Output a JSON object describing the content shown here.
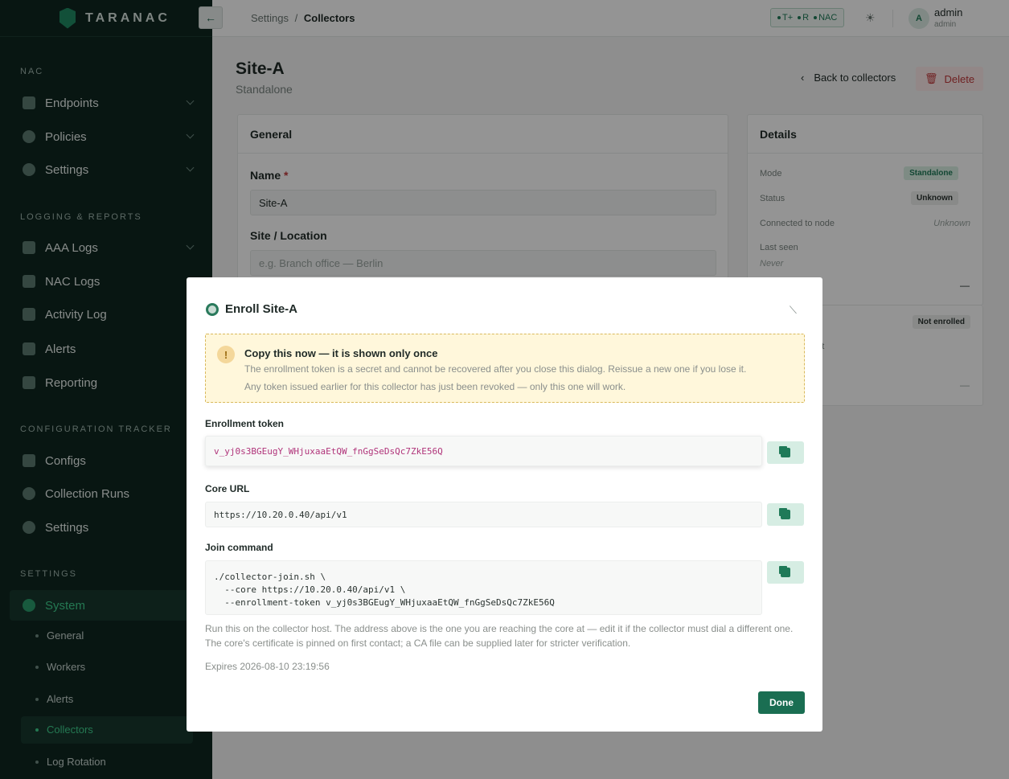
{
  "brand": {
    "name": "TARANAC"
  },
  "sidebar": {
    "sections": [
      {
        "label": "NAC"
      },
      {
        "label": "LOGGING & REPORTS"
      },
      {
        "label": "CONFIGURATION TRACKER"
      },
      {
        "label": "SETTINGS"
      }
    ],
    "nac_items": [
      {
        "label": "Endpoints",
        "icon": "layers-icon"
      },
      {
        "label": "Policies",
        "icon": "shield-icon"
      },
      {
        "label": "Settings",
        "icon": "gear-icon"
      }
    ],
    "log_items": [
      {
        "label": "AAA Logs",
        "icon": "list-icon"
      },
      {
        "label": "NAC Logs",
        "icon": "list-icon"
      },
      {
        "label": "Activity Log",
        "icon": "activity-icon"
      },
      {
        "label": "Alerts",
        "icon": "alert-icon"
      },
      {
        "label": "Reporting",
        "icon": "bar-chart-icon"
      }
    ],
    "config_items": [
      {
        "label": "Configs",
        "icon": "file-icon"
      },
      {
        "label": "Collection Runs",
        "icon": "clock-icon"
      },
      {
        "label": "Settings",
        "icon": "gear-icon"
      }
    ],
    "system": {
      "label": "System",
      "icon": "gear-icon"
    },
    "system_sub": [
      "General",
      "Workers",
      "Alerts",
      "Collectors",
      "Log Rotation"
    ]
  },
  "topbar": {
    "back_icon": "arrow-left-icon",
    "breadcrumb_parent": "Settings",
    "breadcrumb_sep": "/",
    "breadcrumb_current": "Collectors",
    "badges": [
      "T+",
      "R",
      "NAC"
    ],
    "user_initial": "A",
    "user_name": "admin",
    "user_role": "admin"
  },
  "page": {
    "title": "Site-A",
    "subtitle": "Standalone",
    "back_link": "Back to collectors",
    "delete_label": "Delete"
  },
  "general": {
    "heading": "General",
    "name_label": "Name",
    "name_required": "*",
    "name_value": "Site-A",
    "site_label": "Site / Location",
    "site_placeholder": "e.g. Branch office — Berlin"
  },
  "details": {
    "heading": "Details",
    "mode_label": "Mode",
    "mode_value": "Standalone",
    "status_label": "Status",
    "status_value": "Unknown",
    "node_label": "Connected to node",
    "node_value": "Unknown",
    "last_seen_label": "Last seen",
    "last_seen_value": "Never",
    "dash1": "—",
    "enroll_value": "Not enrolled",
    "fingerprint_partial": "rint",
    "dash2": "—"
  },
  "modal": {
    "title": "Enroll Site-A",
    "close_glyph": "⟍",
    "warn_title": "Copy this now — it is shown only once",
    "warn_line1": "The enrollment token is a secret and cannot be recovered after you close this dialog. Reissue a new one if you lose it.",
    "warn_line2": "Any token issued earlier for this collector has just been revoked — only this one will work.",
    "token_label": "Enrollment token",
    "token_value": "v_yj0s3BGEugY_WHjuxaaEtQW_fnGgSeDsQc7ZkE56Q",
    "core_label": "Core URL",
    "core_value": "https://10.20.0.40/api/v1",
    "join_label": "Join command",
    "join_value": "./collector-join.sh \\\n  --core https://10.20.0.40/api/v1 \\\n  --enrollment-token v_yj0s3BGEugY_WHjuxaaEtQW_fnGgSeDsQc7ZkE56Q",
    "help": "Run this on the collector host. The address above is the one you are reaching the core at — edit it if the collector must dial a different one. The core's certificate is pinned on first contact; a CA file can be supplied later for stricter verification.",
    "expires": "Expires 2026-08-10 23:19:56",
    "done_label": "Done"
  },
  "colors": {
    "sidebar_bg": "#0f2620",
    "accent": "#1a6e52",
    "danger": "#c0393b",
    "warning_bg": "#fff7db",
    "token_text": "#b0347a"
  }
}
